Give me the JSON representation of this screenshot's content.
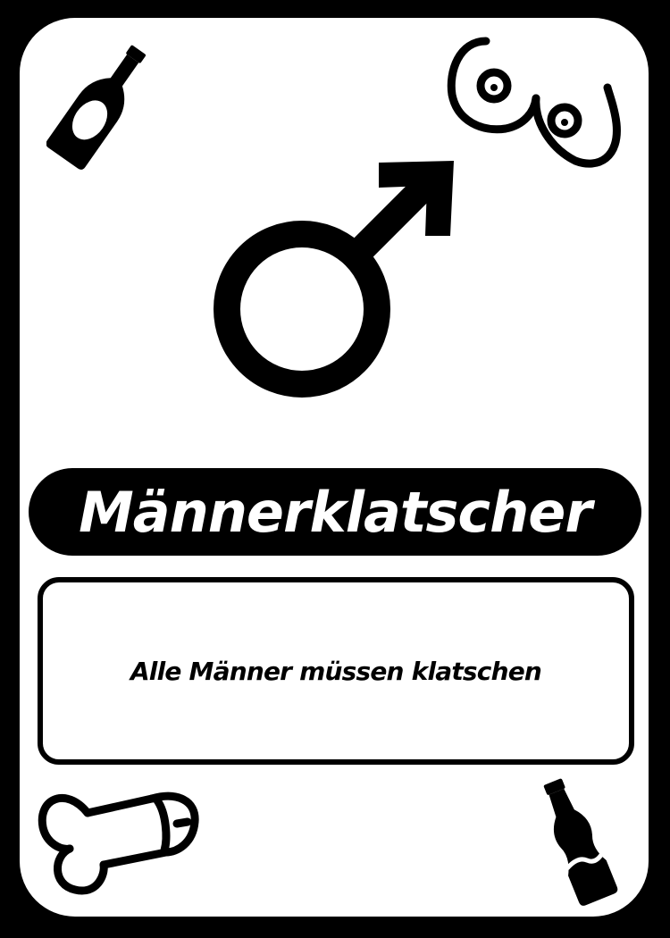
{
  "card": {
    "title": "Männerklatscher",
    "description": "Alle Männer müssen klatschen"
  },
  "icons": {
    "top_left": "beer-bottle-icon",
    "top_right": "breasts-icon",
    "center": "male-symbol-icon",
    "bottom_left": "phallus-icon",
    "bottom_right": "cola-bottle-icon"
  },
  "colors": {
    "background": "#000000",
    "card": "#ffffff",
    "banner": "#000000",
    "title_text": "#ffffff",
    "body_text": "#000000"
  }
}
